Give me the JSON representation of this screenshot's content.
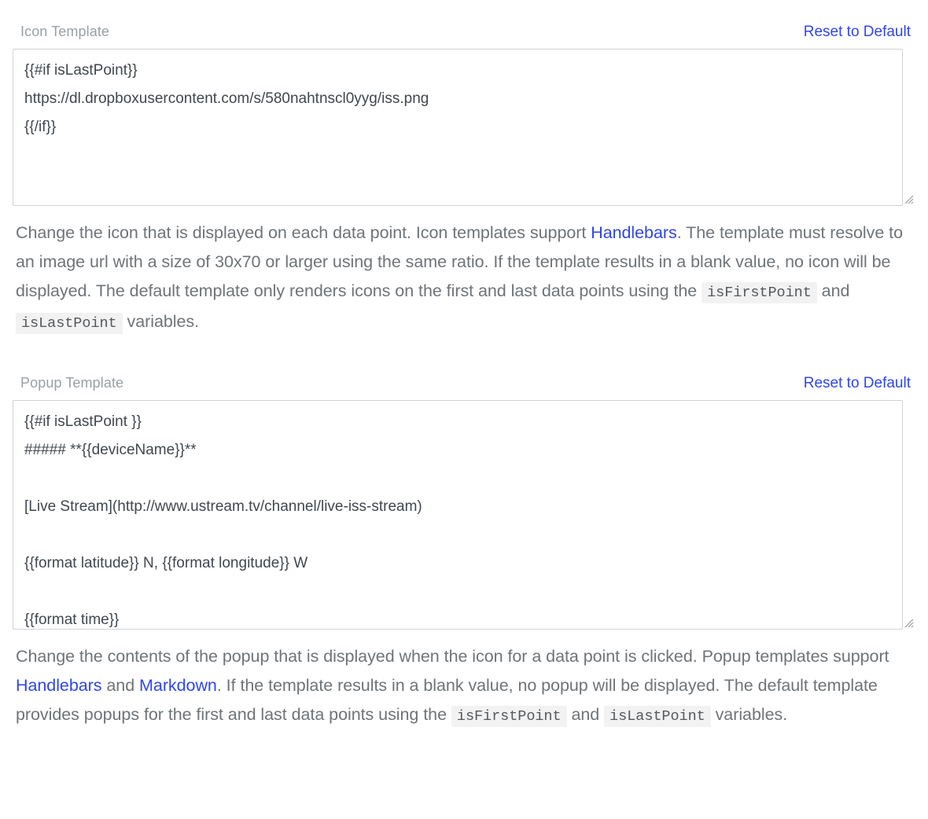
{
  "sections": [
    {
      "key": "icon",
      "label": "Icon Template",
      "reset_label": "Reset to Default",
      "textarea_value": "{{#if isLastPoint}}\nhttps://dl.dropboxusercontent.com/s/580nahtnscl0yyg/iss.png\n{{/if}}",
      "description": {
        "part1": "Change the icon that is displayed on each data point. Icon templates support ",
        "link1": "Handlebars",
        "part2": ". The template must resolve to an image url with a size of 30x70 or larger using the same ratio. If the template results in a blank value, no icon will be displayed. The default template only renders icons on the first and last data points using the ",
        "code1": "isFirstPoint",
        "part3": " and ",
        "code2": "isLastPoint",
        "part4": " variables."
      }
    },
    {
      "key": "popup",
      "label": "Popup Template",
      "reset_label": "Reset to Default",
      "textarea_value": "{{#if isLastPoint }}\n##### **{{deviceName}}**\n\n[Live Stream](http://www.ustream.tv/channel/live-iss-stream)\n\n{{format latitude}} N, {{format longitude}} W\n\n{{format time}}",
      "description": {
        "part1": "Change the contents of the popup that is displayed when the icon for a data point is clicked. Popup templates support ",
        "link1": "Handlebars",
        "part2": " and ",
        "link2": "Markdown",
        "part3": ". If the template results in a blank value, no popup will be displayed. The default template provides popups for the first and last data points using the ",
        "code1": "isFirstPoint",
        "part4": " and ",
        "code2": "isLastPoint",
        "part5": " variables."
      }
    }
  ],
  "colors": {
    "link": "#2f46f0",
    "label": "#9aa0a6",
    "body_text": "#6f7478",
    "input_text": "#41474f",
    "input_border": "#cfd1d4",
    "code_background": "#f2f2f2",
    "page_background": "#ffffff"
  }
}
